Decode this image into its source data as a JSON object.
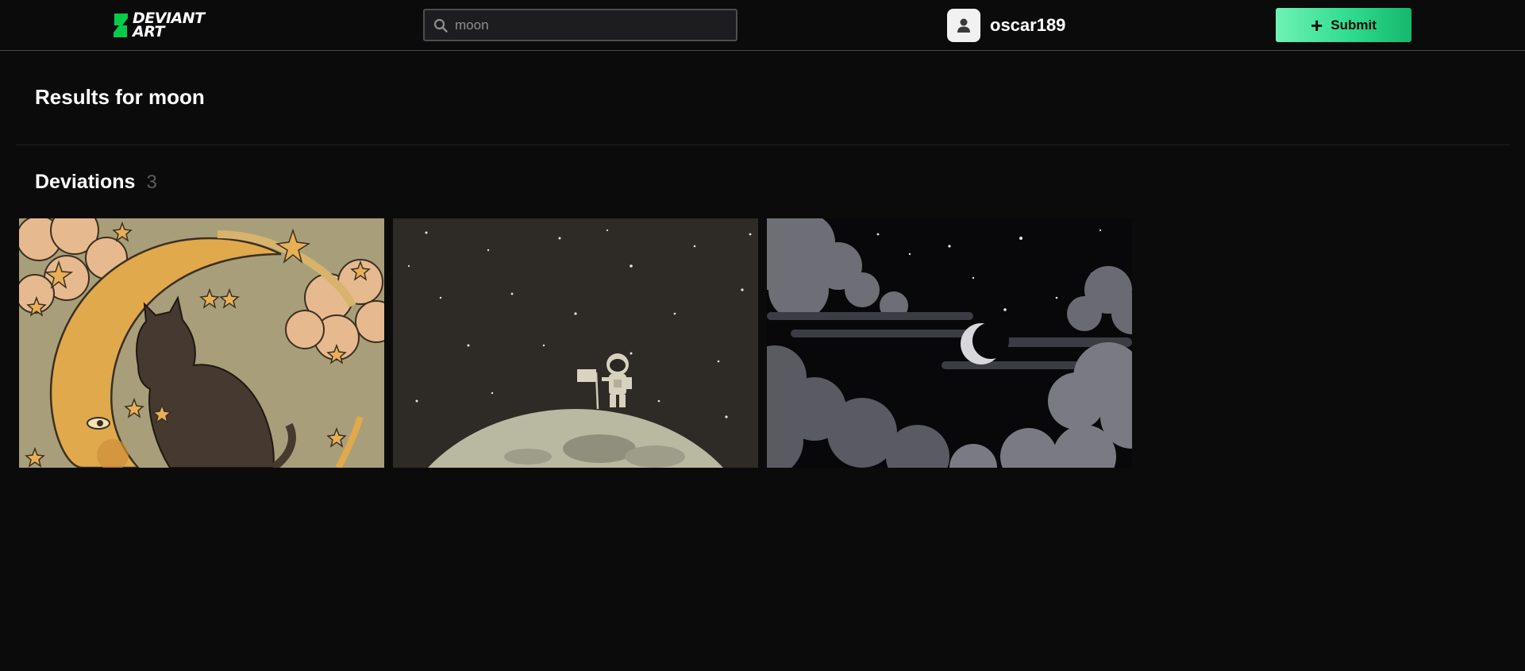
{
  "header": {
    "logo": {
      "line1": "DEVIANT",
      "line2": "ART",
      "icon": "deviantart-logo-icon",
      "accent": "#05cc47"
    },
    "search": {
      "value": "moon",
      "placeholder": "Search",
      "icon": "search-icon"
    },
    "user": {
      "username": "oscar189",
      "avatar_icon": "user-avatar-icon"
    },
    "submit": {
      "label": "Submit",
      "icon": "plus-icon",
      "colors": [
        "#6ff2b4",
        "#14b86d"
      ]
    }
  },
  "results": {
    "prefix": "Results for",
    "query": "moon"
  },
  "deviations": {
    "title": "Deviations",
    "count": "3",
    "items": [
      {
        "name": "cat-on-crescent-moon-thumbnail"
      },
      {
        "name": "astronaut-on-moon-thumbnail"
      },
      {
        "name": "crescent-moon-night-clouds-thumbnail"
      }
    ]
  }
}
